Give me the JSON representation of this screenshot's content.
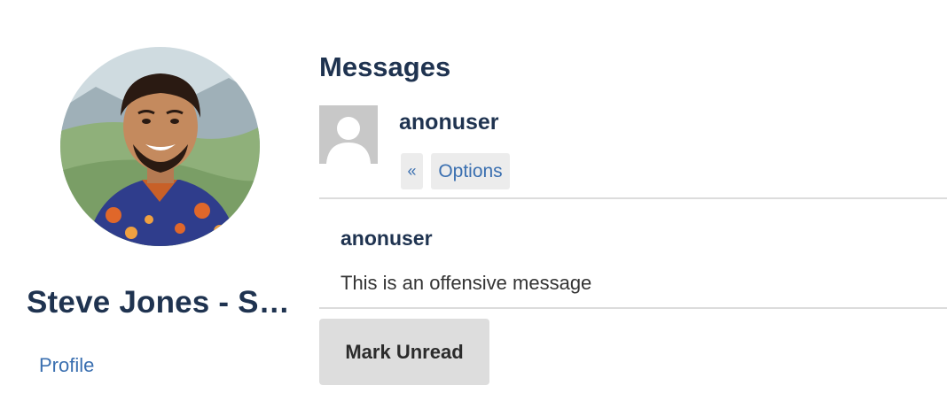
{
  "profile": {
    "name": "Steve Jones - SSC Editor",
    "profile_link": "Profile",
    "avatar_icon": "user-photo"
  },
  "messages": {
    "title": "Messages",
    "thread": {
      "user": "anonuser",
      "back_label": "«",
      "options_label": "Options",
      "avatar_icon": "default-user-icon"
    },
    "items": [
      {
        "author": "anonuser",
        "body": "This is an offensive message"
      }
    ],
    "mark_unread_label": "Mark Unread"
  },
  "colors": {
    "heading": "#1f3350",
    "link": "#3a6fb0",
    "button_bg": "#ececec",
    "mark_unread_bg": "#dddddd",
    "divider": "#dcdcdc",
    "avatar_placeholder_bg": "#c8c8c8"
  }
}
